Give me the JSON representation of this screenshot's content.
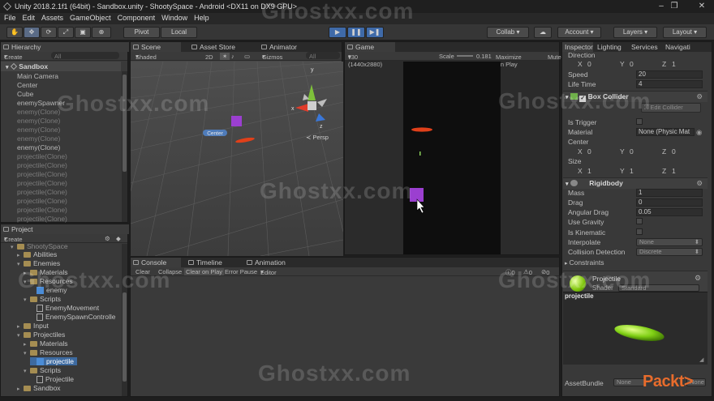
{
  "window": {
    "title": "Unity 2018.2.1f1 (64bit) - Sandbox.unity - ShootySpace - Android <DX11 on DX9 GPU>"
  },
  "menu": [
    "File",
    "Edit",
    "Assets",
    "GameObject",
    "Component",
    "Window",
    "Help"
  ],
  "toolbar": {
    "pivot": "Pivot",
    "local": "Local",
    "collab": "Collab",
    "account": "Account",
    "layers": "Layers",
    "layout": "Layout"
  },
  "hierarchy": {
    "tab": "Hierarchy",
    "create": "Create",
    "search_placeholder": "All",
    "scene": "Sandbox",
    "items": [
      {
        "label": "Main Camera",
        "dim": false
      },
      {
        "label": "Center",
        "dim": false
      },
      {
        "label": "Cube",
        "dim": false
      },
      {
        "label": "enemySpawner",
        "dim": false
      },
      {
        "label": "enemy(Clone)",
        "dim": true
      },
      {
        "label": "enemy(Clone)",
        "dim": true
      },
      {
        "label": "enemy(Clone)",
        "dim": true
      },
      {
        "label": "enemy(Clone)",
        "dim": true
      },
      {
        "label": "enemy(Clone)",
        "dim": false
      },
      {
        "label": "projectile(Clone)",
        "dim": true
      },
      {
        "label": "projectile(Clone)",
        "dim": true
      },
      {
        "label": "projectile(Clone)",
        "dim": true
      },
      {
        "label": "projectile(Clone)",
        "dim": true
      },
      {
        "label": "projectile(Clone)",
        "dim": true
      },
      {
        "label": "projectile(Clone)",
        "dim": true
      },
      {
        "label": "projectile(Clone)",
        "dim": true
      },
      {
        "label": "projectile(Clone)",
        "dim": true
      }
    ]
  },
  "project": {
    "tab": "Project",
    "create": "Create",
    "root": "ShootySpace",
    "items": [
      {
        "label": "Abilities",
        "kind": "folder",
        "indent": 1,
        "arrow": "▸"
      },
      {
        "label": "Enemies",
        "kind": "folder",
        "indent": 1,
        "arrow": "▾"
      },
      {
        "label": "Materials",
        "kind": "folder",
        "indent": 2,
        "arrow": "▸"
      },
      {
        "label": "Resources",
        "kind": "folder",
        "indent": 2,
        "arrow": "▾"
      },
      {
        "label": "enemy",
        "kind": "prefab",
        "indent": 3,
        "arrow": ""
      },
      {
        "label": "Scripts",
        "kind": "folder",
        "indent": 2,
        "arrow": "▾"
      },
      {
        "label": "EnemyMovement",
        "kind": "file",
        "indent": 3,
        "arrow": ""
      },
      {
        "label": "EnemySpawnControlle",
        "kind": "file",
        "indent": 3,
        "arrow": ""
      },
      {
        "label": "Input",
        "kind": "folder",
        "indent": 1,
        "arrow": "▸"
      },
      {
        "label": "Projectiles",
        "kind": "folder",
        "indent": 1,
        "arrow": "▾"
      },
      {
        "label": "Materials",
        "kind": "folder",
        "indent": 2,
        "arrow": "▸"
      },
      {
        "label": "Resources",
        "kind": "folder",
        "indent": 2,
        "arrow": "▾"
      },
      {
        "label": "projectile",
        "kind": "prefab",
        "indent": 3,
        "arrow": "",
        "selected": true
      },
      {
        "label": "Scripts",
        "kind": "folder",
        "indent": 2,
        "arrow": "▾"
      },
      {
        "label": "Projectile",
        "kind": "file",
        "indent": 3,
        "arrow": ""
      },
      {
        "label": "Sandbox",
        "kind": "folder",
        "indent": 1,
        "arrow": "▸"
      }
    ]
  },
  "scene": {
    "tabs": [
      "Scene",
      "Asset Store",
      "Animator"
    ],
    "shading": "Shaded",
    "mode2d": "2D",
    "gizmos": "Gizmos",
    "search": "All",
    "center_label": "Center",
    "persp": "Persp",
    "axis_x": "x",
    "axis_y": "y",
    "axis_z": "z"
  },
  "game": {
    "tab": "Game",
    "resolution": "v30 (1440x2880)",
    "scale_label": "Scale",
    "scale_value": "0.181",
    "maximize": "Maximize On Play",
    "mute": "Mute"
  },
  "console": {
    "tabs": [
      "Console",
      "Timeline",
      "Animation"
    ],
    "buttons": [
      "Clear",
      "Collapse",
      "Clear on Play",
      "Error Pause",
      "Editor"
    ],
    "counts": [
      "0",
      "0",
      "0"
    ]
  },
  "inspector": {
    "tabs": [
      "Inspector",
      "Lighting",
      "Services",
      "Navigati"
    ],
    "direction_label": "Direction",
    "direction": {
      "x": "0",
      "y": "0",
      "z": "1"
    },
    "speed_label": "Speed",
    "speed": "20",
    "lifetime_label": "Life Time",
    "lifetime": "4",
    "box_collider": {
      "title": "Box Collider",
      "edit_label": "Edit Collider",
      "is_trigger": "Is Trigger",
      "material_label": "Material",
      "material": "None (Physic Mat",
      "center_label": "Center",
      "center": {
        "x": "0",
        "y": "0",
        "z": "0"
      },
      "size_label": "Size",
      "size": {
        "x": "1",
        "y": "1",
        "z": "1"
      }
    },
    "rigidbody": {
      "title": "Rigidbody",
      "mass_label": "Mass",
      "mass": "1",
      "drag_label": "Drag",
      "drag": "0",
      "angular_drag_label": "Angular Drag",
      "angular_drag": "0.05",
      "use_gravity": "Use Gravity",
      "is_kinematic": "Is Kinematic",
      "interpolate_label": "Interpolate",
      "interpolate": "None",
      "collision_label": "Collision Detection",
      "collision": "Discrete",
      "constraints": "Constraints"
    },
    "material": {
      "name": "Projectile",
      "shader_label": "Shader",
      "shader": "Standard"
    },
    "preview_title": "projectile",
    "assetbundle_label": "AssetBundle",
    "assetbundle": "None",
    "assetbundle2": "None"
  },
  "watermark": "Ghostxx.com",
  "brand": "Packt>"
}
